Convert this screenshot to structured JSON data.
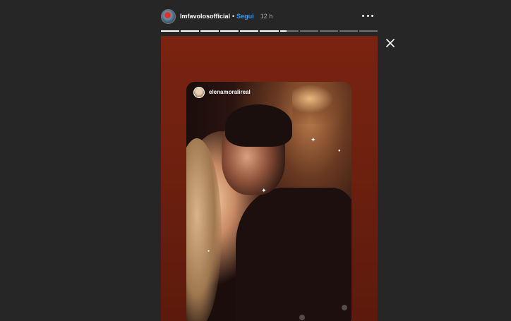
{
  "header": {
    "username": "lmfavolosofficial",
    "separator": "•",
    "follow_label": "Segui",
    "timestamp": "12 h",
    "avatar_icon": "profile-avatar",
    "more_icon": "more-horizontal-icon"
  },
  "progress": {
    "segments_total": 11,
    "segments_completed": 6,
    "current_segment_fraction": 0.35
  },
  "close_icon": "close-icon",
  "story": {
    "reposted_username": "elenamoralireal"
  },
  "colors": {
    "background": "#262626",
    "follow": "#3897f0",
    "media_tint": "#6f210f"
  }
}
